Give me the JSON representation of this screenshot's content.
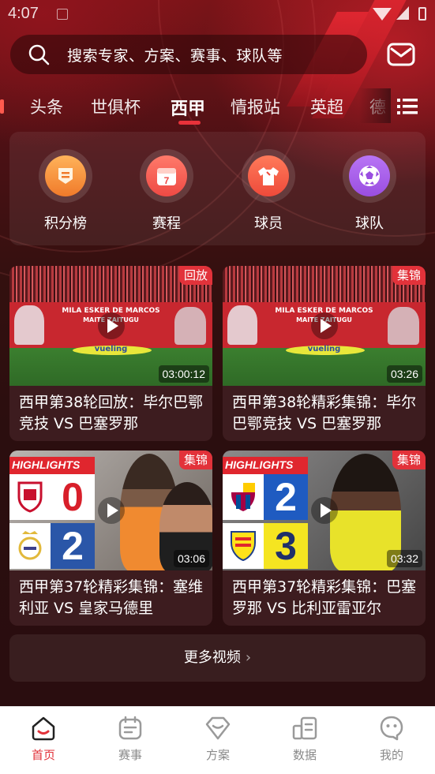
{
  "status_bar": {
    "time": "4:07"
  },
  "search": {
    "placeholder": "搜索专家、方案、赛事、球队等"
  },
  "tabs": [
    {
      "label": "头条"
    },
    {
      "label": "世俱杯"
    },
    {
      "label": "西甲",
      "active": true
    },
    {
      "label": "情报站"
    },
    {
      "label": "英超"
    },
    {
      "label": "德"
    }
  ],
  "shortcuts": [
    {
      "label": "积分榜",
      "icon": "standings-icon",
      "color": "#f07a2a"
    },
    {
      "label": "赛程",
      "icon": "calendar-icon",
      "color": "#ee4a44",
      "icon_text": "7"
    },
    {
      "label": "球员",
      "icon": "jersey-icon",
      "color": "#ee4a3a"
    },
    {
      "label": "球队",
      "icon": "soccer-ball-icon",
      "color": "#9a4ee0"
    }
  ],
  "videos": [
    {
      "badge": "回放",
      "duration": "03:00:12",
      "title": "西甲第38轮回放：毕尔巴鄂竞技 VS 巴塞罗那",
      "banner_line1": "MILA ESKER DE MARCOS",
      "banner_line2": "MAITE ZAITUGU",
      "ad_text": "vueling"
    },
    {
      "badge": "集锦",
      "duration": "03:26",
      "title": "西甲第38轮精彩集锦：毕尔巴鄂竞技 VS 巴塞罗那",
      "banner_line1": "MILA ESKER DE MARCOS",
      "banner_line2": "MAITE ZAITUGU",
      "ad_text": "vueling"
    },
    {
      "badge": "集锦",
      "duration": "03:06",
      "title": "西甲第37轮精彩集锦：塞维利亚 VS 皇家马德里",
      "highlights_label": "HIGHLIGHTS",
      "score_home": "0",
      "score_away": "2"
    },
    {
      "badge": "集锦",
      "duration": "03:32",
      "title": "西甲第37轮精彩集锦：巴塞罗那 VS 比利亚雷亚尔",
      "highlights_label": "HIGHLIGHTS",
      "score_home": "2",
      "score_away": "3"
    }
  ],
  "more_videos": {
    "label": "更多视频"
  },
  "bottom_nav": [
    {
      "label": "首页",
      "icon": "home-icon",
      "active": true
    },
    {
      "label": "赛事",
      "icon": "schedule-icon"
    },
    {
      "label": "方案",
      "icon": "plan-icon"
    },
    {
      "label": "数据",
      "icon": "data-icon"
    },
    {
      "label": "我的",
      "icon": "profile-icon"
    }
  ],
  "colors": {
    "accent": "#e2323a",
    "background": "#2a0d0f"
  }
}
